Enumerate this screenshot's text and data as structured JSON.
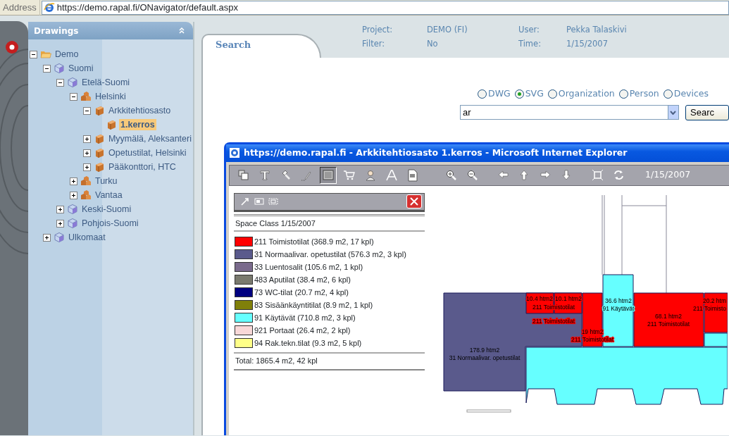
{
  "address_bar": {
    "label": "Address",
    "url": "https://demo.rapal.fi/ONavigator/default.aspx"
  },
  "sidebar": {
    "title": "Drawings",
    "tree": [
      {
        "label": "Demo",
        "kind": "folder",
        "expanded": true,
        "selected": false,
        "children": [
          {
            "label": "Suomi",
            "kind": "region",
            "expanded": true,
            "selected": false,
            "children": [
              {
                "label": "Etelä-Suomi",
                "kind": "region",
                "expanded": true,
                "selected": false,
                "children": [
                  {
                    "label": "Helsinki",
                    "kind": "city",
                    "expanded": true,
                    "selected": false,
                    "children": [
                      {
                        "label": "Arkkitehtiosasto",
                        "kind": "building",
                        "expanded": true,
                        "selected": false,
                        "children": [
                          {
                            "label": "1.kerros",
                            "kind": "building",
                            "selected": true
                          }
                        ]
                      },
                      {
                        "label": "Myymälä, Aleksanteri",
                        "kind": "building",
                        "expanded": false,
                        "selected": false
                      },
                      {
                        "label": "Opetustilat, Helsinki",
                        "kind": "building",
                        "expanded": false,
                        "selected": false
                      },
                      {
                        "label": "Pääkonttori, HTC",
                        "kind": "building",
                        "expanded": false,
                        "selected": false
                      }
                    ]
                  },
                  {
                    "label": "Turku",
                    "kind": "city",
                    "expanded": false,
                    "selected": false
                  },
                  {
                    "label": "Vantaa",
                    "kind": "city",
                    "expanded": false,
                    "selected": false
                  }
                ]
              },
              {
                "label": "Keski-Suomi",
                "kind": "region",
                "expanded": false,
                "selected": false
              },
              {
                "label": "Pohjois-Suomi",
                "kind": "region",
                "expanded": false,
                "selected": false
              }
            ]
          },
          {
            "label": "Ulkomaat",
            "kind": "region",
            "expanded": false,
            "selected": false
          }
        ]
      }
    ]
  },
  "header": {
    "info": [
      {
        "label": "Project:",
        "value": "DEMO (FI)"
      },
      {
        "label": "User:",
        "value": "Pekka Talaskivi"
      },
      {
        "label": "Filter:",
        "value": "No"
      },
      {
        "label": "Time:",
        "value": "1/15/2007"
      }
    ],
    "tab": "Search"
  },
  "search": {
    "options": [
      {
        "label": "DWG",
        "selected": false
      },
      {
        "label": "SVG",
        "selected": true
      },
      {
        "label": "Organization",
        "selected": false
      },
      {
        "label": "Person",
        "selected": false
      },
      {
        "label": "Devices",
        "selected": false
      }
    ],
    "value": "ar",
    "button": "Searc"
  },
  "popup": {
    "title": "https://demo.rapal.fi - Arkkitehtiosasto 1.kerros - Microsoft Internet Explorer",
    "tools": [
      {
        "selected": false
      },
      {
        "selected": false
      },
      {
        "selected": false
      },
      {
        "selected": false
      },
      {
        "selected": true
      },
      {
        "selected": false
      },
      {
        "selected": false
      },
      {
        "selected": false
      },
      {
        "selected": false
      }
    ],
    "date": "1/15/2007",
    "legend": {
      "title": "Space Class 1/15/2007",
      "items": [
        {
          "label": "211 Toimistotilat (368.9 m2, 17 kpl)",
          "color": "#ff0000"
        },
        {
          "label": "31 Normaalivar. opetustilat (576.3 m2, 3 kpl)",
          "color": "#5a5a8c"
        },
        {
          "label": "33 Luentosalit (105.6 m2, 1 kpl)",
          "color": "#7a6a8c"
        },
        {
          "label": "483 Aputilat (38.4 m2, 6 kpl)",
          "color": "#7a7a6e"
        },
        {
          "label": "73 WC-tilat (20.7 m2, 4 kpl)",
          "color": "#000080"
        },
        {
          "label": "83 Sisäänkäyntitilat (8.9 m2, 1 kpl)",
          "color": "#80800a"
        },
        {
          "label": "91 Käytävät (710.8 m2, 3 kpl)",
          "color": "#66ffff"
        },
        {
          "label": "921 Portaat (26.4 m2, 2 kpl)",
          "color": "#f8d8d8"
        },
        {
          "label": "94 Rak.tekn.tilat (9.3 m2, 5 kpl)",
          "color": "#ffff88"
        }
      ],
      "total": "Total: 1865.4 m2, 42 kpl"
    },
    "rooms": [
      {
        "area": "178.9 htm2",
        "label": "31 Normaalivar. opetustilat",
        "color": "#5a5a8c"
      },
      {
        "area": "10.4 htm2",
        "label": "211 Toimistotilat",
        "color": "#ff0000"
      },
      {
        "area": "10.1 htm2",
        "label": "211 Toimistotilat",
        "color": "#ff0000"
      },
      {
        "area": "19 htm2",
        "label": "211 Toimistotilat",
        "color": "#ff0000"
      },
      {
        "area": "36.6 htm2",
        "label": "91 Käytävät",
        "color": "#66ffff"
      },
      {
        "area": "68.1 htm2",
        "label": "211 Toimistotilat",
        "color": "#ff0000"
      },
      {
        "area": "20.2 htm",
        "label": "211 Toimisto",
        "color": "#ff0000"
      },
      {
        "color": "#66ffff"
      },
      {
        "color": "#66ffff"
      }
    ]
  }
}
